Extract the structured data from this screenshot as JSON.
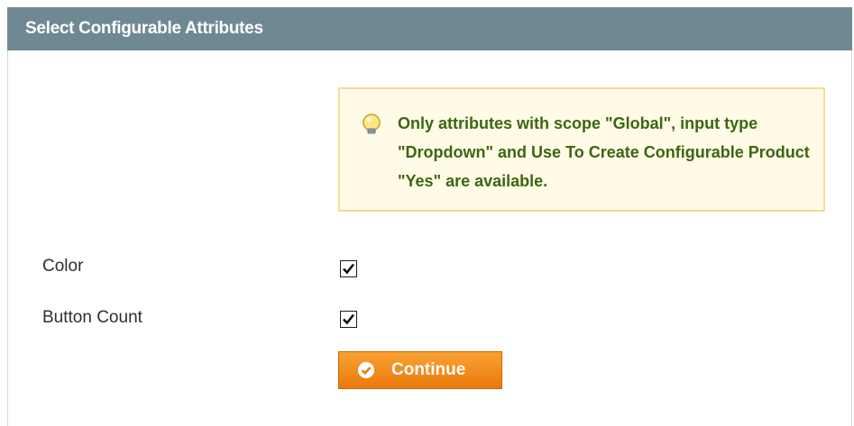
{
  "section": {
    "title": "Select Configurable Attributes"
  },
  "notice": {
    "icon": "lightbulb-icon",
    "text": "Only attributes with scope \"Global\", input type \"Dropdown\" and Use To Create Configurable Product \"Yes\" are available."
  },
  "attributes": [
    {
      "label": "Color",
      "checked": true
    },
    {
      "label": "Button Count",
      "checked": true
    }
  ],
  "continue_button": {
    "label": "Continue",
    "icon": "check-circle-icon"
  },
  "colors": {
    "header_bg": "#6f8992",
    "notice_bg": "#fffbe6",
    "notice_border": "#f3dc96",
    "notice_text": "#3d6611",
    "button_orange": "#f18a1f"
  }
}
